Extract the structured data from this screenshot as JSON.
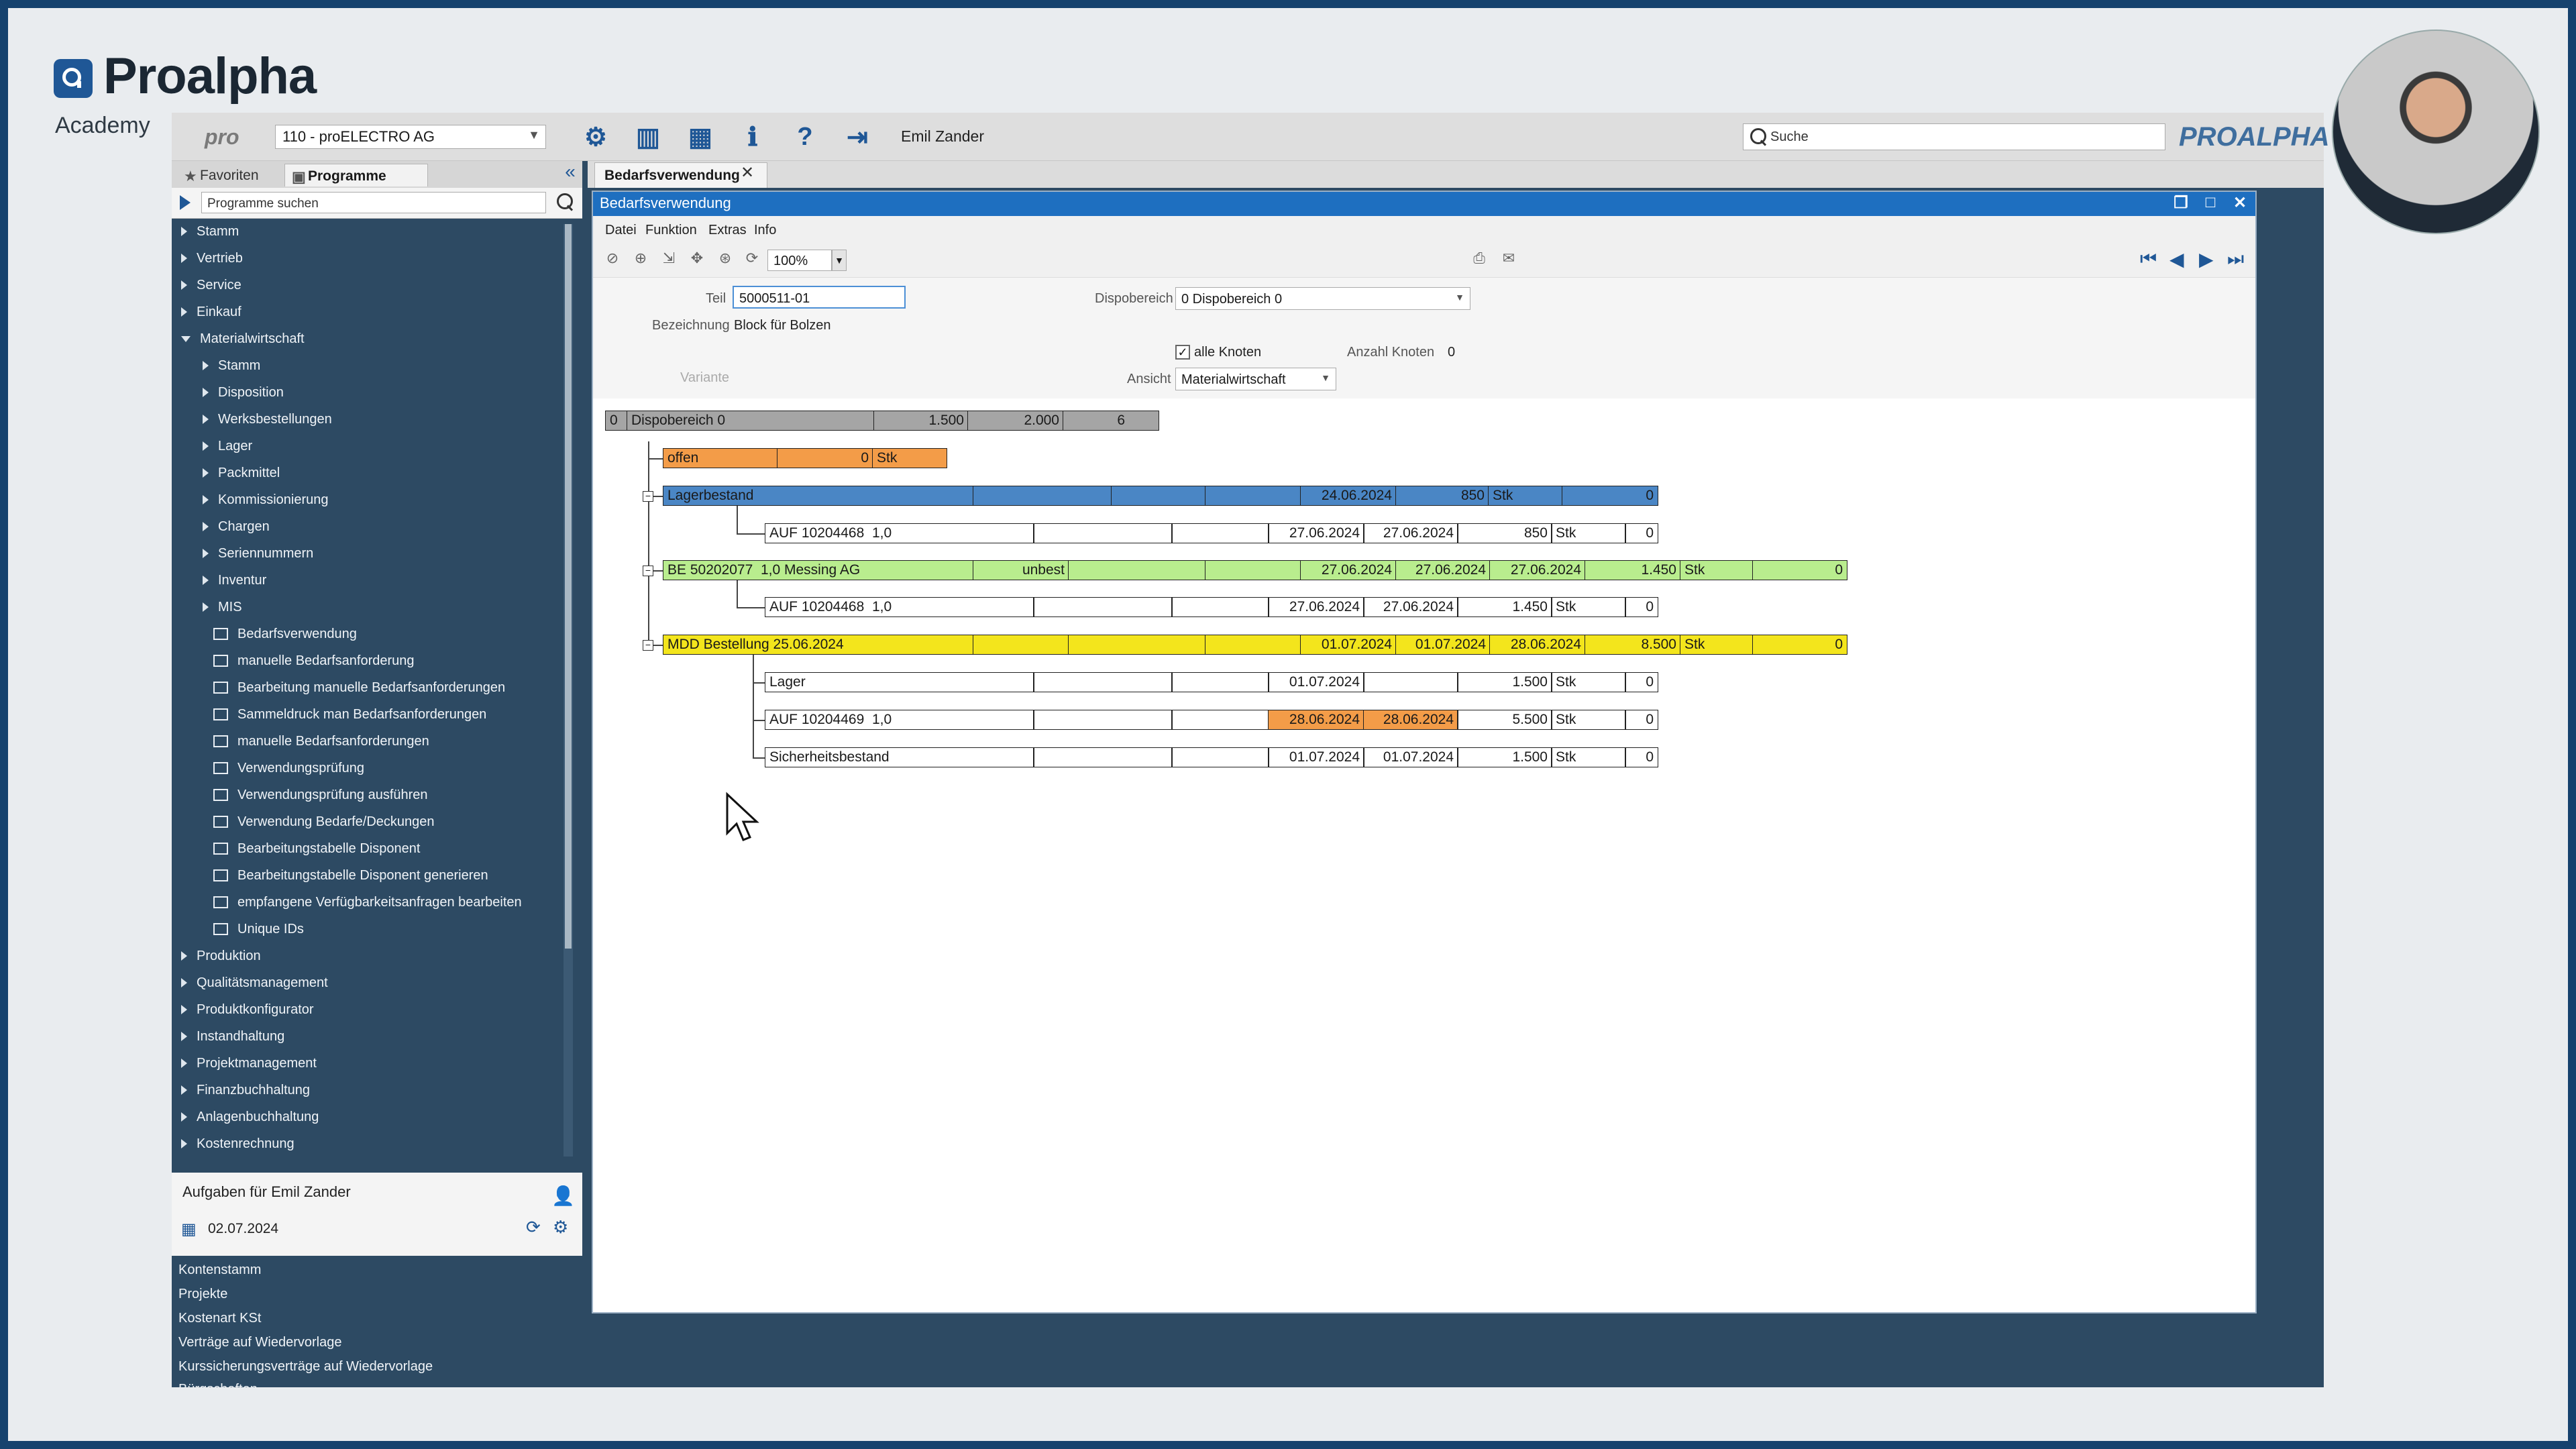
{
  "brand": {
    "name": "Proalpha",
    "subtitle": "Academy"
  },
  "toolbar": {
    "pro_label": "pro",
    "company": "110 - proELECTRO AG",
    "user": "Emil Zander",
    "search_placeholder": "Suche",
    "brand_mark": "PROALPHA"
  },
  "nav": {
    "tabs": {
      "favorites": "Favoriten",
      "programs": "Programme"
    },
    "search_placeholder": "Programme suchen",
    "tree": [
      {
        "label": "Stamm",
        "level": 0,
        "kind": "folder"
      },
      {
        "label": "Vertrieb",
        "level": 0,
        "kind": "folder"
      },
      {
        "label": "Service",
        "level": 0,
        "kind": "folder"
      },
      {
        "label": "Einkauf",
        "level": 0,
        "kind": "folder"
      },
      {
        "label": "Materialwirtschaft",
        "level": 0,
        "kind": "open"
      },
      {
        "label": "Stamm",
        "level": 1,
        "kind": "folder"
      },
      {
        "label": "Disposition",
        "level": 1,
        "kind": "folder"
      },
      {
        "label": "Werksbestellungen",
        "level": 1,
        "kind": "folder"
      },
      {
        "label": "Lager",
        "level": 1,
        "kind": "folder"
      },
      {
        "label": "Packmittel",
        "level": 1,
        "kind": "folder"
      },
      {
        "label": "Kommissionierung",
        "level": 1,
        "kind": "folder"
      },
      {
        "label": "Chargen",
        "level": 1,
        "kind": "folder"
      },
      {
        "label": "Seriennummern",
        "level": 1,
        "kind": "folder"
      },
      {
        "label": "Inventur",
        "level": 1,
        "kind": "folder"
      },
      {
        "label": "MIS",
        "level": 1,
        "kind": "folder"
      },
      {
        "label": "Bedarfsverwendung",
        "level": 2,
        "kind": "doc"
      },
      {
        "label": "manuelle Bedarfsanforderung",
        "level": 2,
        "kind": "doc"
      },
      {
        "label": "Bearbeitung manuelle Bedarfsanforderungen",
        "level": 2,
        "kind": "doc"
      },
      {
        "label": "Sammeldruck man Bedarfsanforderungen",
        "level": 2,
        "kind": "doc"
      },
      {
        "label": "manuelle Bedarfsanforderungen",
        "level": 2,
        "kind": "doc"
      },
      {
        "label": "Verwendungsprüfung",
        "level": 2,
        "kind": "doc"
      },
      {
        "label": "Verwendungsprüfung ausführen",
        "level": 2,
        "kind": "doc"
      },
      {
        "label": "Verwendung Bedarfe/Deckungen",
        "level": 2,
        "kind": "doc"
      },
      {
        "label": "Bearbeitungstabelle Disponent",
        "level": 2,
        "kind": "doc"
      },
      {
        "label": "Bearbeitungstabelle Disponent generieren",
        "level": 2,
        "kind": "doc"
      },
      {
        "label": "empfangene Verfügbarkeitsanfragen bearbeiten",
        "level": 2,
        "kind": "doc"
      },
      {
        "label": "Unique IDs",
        "level": 2,
        "kind": "doc"
      },
      {
        "label": "Produktion",
        "level": 0,
        "kind": "folder"
      },
      {
        "label": "Qualitätsmanagement",
        "level": 0,
        "kind": "folder"
      },
      {
        "label": "Produktkonfigurator",
        "level": 0,
        "kind": "folder"
      },
      {
        "label": "Instandhaltung",
        "level": 0,
        "kind": "folder"
      },
      {
        "label": "Projektmanagement",
        "level": 0,
        "kind": "folder"
      },
      {
        "label": "Finanzbuchhaltung",
        "level": 0,
        "kind": "folder"
      },
      {
        "label": "Anlagenbuchhaltung",
        "level": 0,
        "kind": "folder"
      },
      {
        "label": "Kostenrechnung",
        "level": 0,
        "kind": "folder"
      }
    ]
  },
  "tasks": {
    "title": "Aufgaben für Emil Zander",
    "date": "02.07.2024",
    "list": [
      "Kontenstamm",
      "Projekte",
      "Kostenart KSt",
      "Verträge auf Wiedervorlage",
      "Kurssicherungsverträge auf Wiedervorlage",
      "Bürgschaften"
    ]
  },
  "doc_tab": {
    "label": "Bedarfsverwendung"
  },
  "window": {
    "title": "Bedarfsverwendung",
    "menu": [
      "Datei",
      "Funktion",
      "Extras",
      "Info"
    ],
    "zoom": "100%"
  },
  "form": {
    "teil_label": "Teil",
    "teil_value": "5000511-01",
    "bezeichnung_label": "Bezeichnung",
    "bezeichnung_value": "Block für Bolzen",
    "variante_label": "Variante",
    "dispobereich_label": "Dispobereich",
    "dispobereich_value": "0 Dispobereich 0",
    "alle_knoten_label": "alle Knoten",
    "alle_knoten_checked": true,
    "anzahl_knoten_label": "Anzahl Knoten",
    "anzahl_knoten_value": "0",
    "ansicht_label": "Ansicht",
    "ansicht_value": "Materialwirtschaft"
  },
  "tree_rows": {
    "root": [
      "0",
      "Dispobereich 0",
      "1.500",
      "2.000",
      "6"
    ],
    "offen": [
      "offen",
      "0",
      "Stk"
    ],
    "lager": [
      "Lagerbestand",
      "24.06.2024",
      "850",
      "Stk",
      "0"
    ],
    "lager_auf": [
      "AUF 10204468",
      "1,0",
      "27.06.2024",
      "27.06.2024",
      "850",
      "Stk",
      "0"
    ],
    "be": [
      "BE 50202077",
      "1,0 Messing AG",
      "unbest",
      "27.06.2024",
      "27.06.2024",
      "27.06.2024",
      "1.450",
      "Stk",
      "0"
    ],
    "be_auf": [
      "AUF 10204468",
      "1,0",
      "27.06.2024",
      "27.06.2024",
      "1.450",
      "Stk",
      "0"
    ],
    "mdd": [
      "MDD Bestellung 25.06.2024",
      "01.07.2024",
      "01.07.2024",
      "28.06.2024",
      "8.500",
      "Stk",
      "0"
    ],
    "mdd_lager": [
      "Lager",
      "01.07.2024",
      "1.500",
      "Stk",
      "0"
    ],
    "mdd_auf": [
      "AUF 10204469",
      "1,0",
      "28.06.2024",
      "28.06.2024",
      "5.500",
      "Stk",
      "0"
    ],
    "mdd_sicher": [
      "Sicherheitsbestand",
      "01.07.2024",
      "01.07.2024",
      "1.500",
      "Stk",
      "0"
    ]
  },
  "colors": {
    "root": "#a5a5a5",
    "offen": "#f39c48",
    "lager": "#4a86c5",
    "be": "#b9ed8e",
    "mdd": "#f3e51c",
    "late": "#f39c48",
    "window_title": "#1e6fc0",
    "nav_bg": "#2d4a63"
  }
}
